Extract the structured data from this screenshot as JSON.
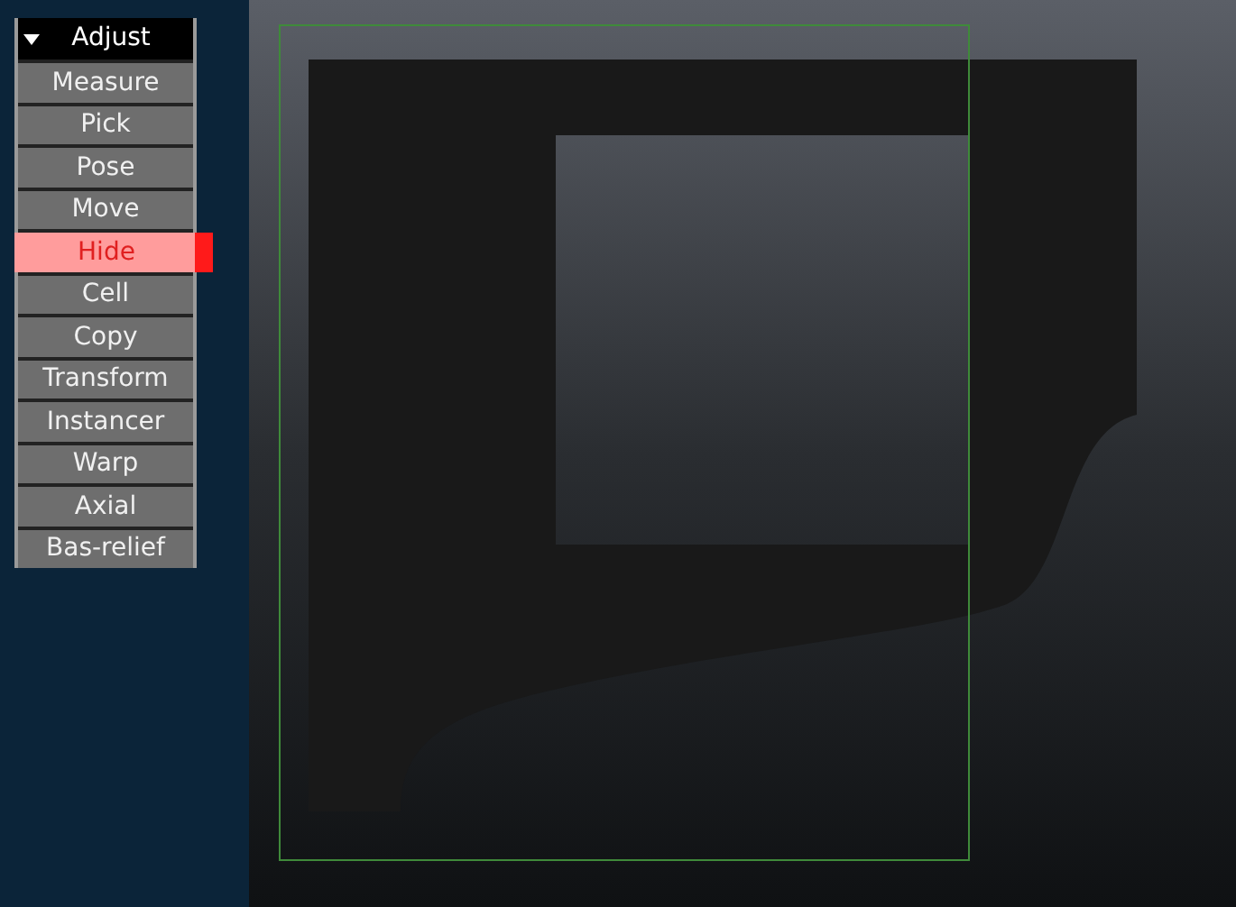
{
  "menu": {
    "title": "Adjust",
    "expanded": true,
    "items": [
      {
        "label": "Measure",
        "selected": false
      },
      {
        "label": "Pick",
        "selected": false
      },
      {
        "label": "Pose",
        "selected": false
      },
      {
        "label": "Move",
        "selected": false
      },
      {
        "label": "Hide",
        "selected": true
      },
      {
        "label": "Cell",
        "selected": false
      },
      {
        "label": "Copy",
        "selected": false
      },
      {
        "label": "Transform",
        "selected": false
      },
      {
        "label": "Instancer",
        "selected": false
      },
      {
        "label": "Warp",
        "selected": false
      },
      {
        "label": "Axial",
        "selected": false
      },
      {
        "label": "Bas-relief",
        "selected": false
      }
    ]
  }
}
